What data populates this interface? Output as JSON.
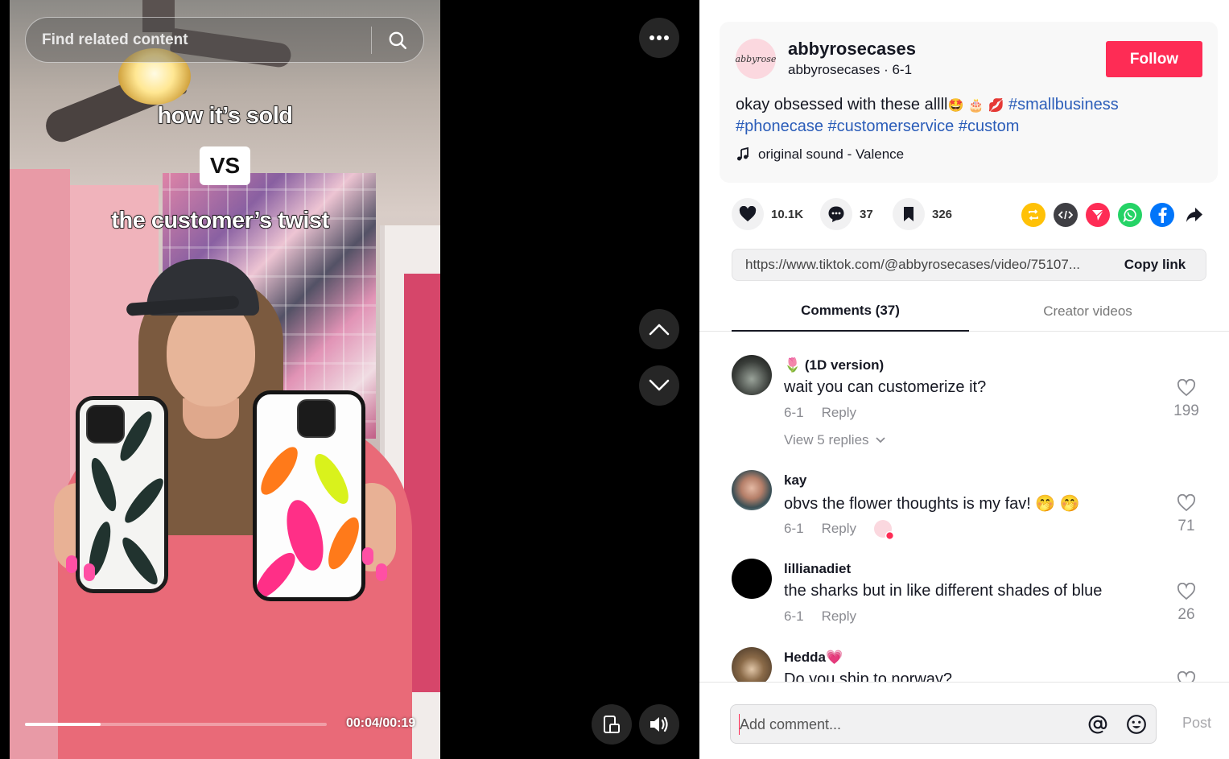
{
  "search": {
    "placeholder": "Find related content"
  },
  "video": {
    "caption_top": "how it’s sold",
    "caption_vs": "VS",
    "caption_bottom": "the customer’s twist",
    "time": "00:04/00:19",
    "progress": 0.25
  },
  "author": {
    "avatar_text": "abbyrose",
    "username": "abbyrosecases",
    "subline": "abbyrosecases · 6-1",
    "follow_label": "Follow"
  },
  "description": {
    "text": "okay obsessed with these allll",
    "emojis": "🤩 🎂 💋",
    "hashtags": [
      "#smallbusiness",
      "#phonecase",
      "#customerservice",
      "#custom"
    ],
    "music": "original sound - Valence"
  },
  "stats": {
    "likes": "10.1K",
    "comments": "37",
    "saves": "326"
  },
  "share": {
    "icons": [
      "repost-icon",
      "embed-icon",
      "send-icon",
      "whatsapp-icon",
      "facebook-icon",
      "share-arrow-icon"
    ],
    "colors": {
      "repost": "#ffc107",
      "embed": "#3f3f44",
      "send": "#fe2c55",
      "whatsapp": "#25d366",
      "facebook": "#0075fa"
    }
  },
  "link": {
    "url": "https://www.tiktok.com/@abbyrosecases/video/75107...",
    "copy_label": "Copy link"
  },
  "tabs": {
    "comments": "Comments (37)",
    "creator": "Creator videos"
  },
  "comments": [
    {
      "user": "🌷 (1D version)",
      "text": "wait you can customerize it?",
      "date": "6-1",
      "reply": "Reply",
      "likes": "199",
      "view_replies": "View 5 replies"
    },
    {
      "user": "kay",
      "text": "obvs the flower thoughts is my fav! 🤭 🤭",
      "date": "6-1",
      "reply": "Reply",
      "likes": "71"
    },
    {
      "user": "lillianadiet",
      "text": "the sharks but in like different shades of blue",
      "date": "6-1",
      "reply": "Reply",
      "likes": "26"
    },
    {
      "user": "Hedda💗",
      "text": "Do you ship to norway?",
      "date": "",
      "reply": "",
      "likes": ""
    }
  ],
  "comment_bar": {
    "placeholder": "Add comment...",
    "post_label": "Post"
  },
  "colors": {
    "accent": "#fe2c55",
    "hashtag": "#2b5db9"
  }
}
